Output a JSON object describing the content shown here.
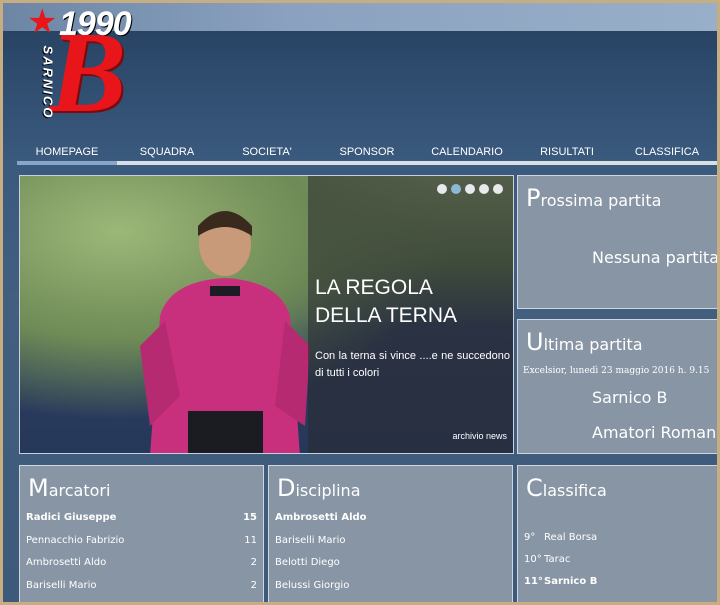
{
  "logo": {
    "year": "1990",
    "letter": "B",
    "name": "SARNICO",
    "star": "★"
  },
  "nav": [
    {
      "label": "HOMEPAGE"
    },
    {
      "label": "SQUADRA"
    },
    {
      "label": "SOCIETA'"
    },
    {
      "label": "SPONSOR"
    },
    {
      "label": "CALENDARIO"
    },
    {
      "label": "RISULTATI"
    },
    {
      "label": "CLASSIFICA"
    }
  ],
  "hero": {
    "title_line1": "LA REGOLA",
    "title_line2": "DELLA TERNA",
    "text": "Con la terna si vince ....e ne succedono di tutti i colori",
    "archive": "archivio news",
    "slides": 5,
    "active_slide": 2
  },
  "next_match": {
    "title_first": "P",
    "title_rest": "rossima partita",
    "status": "Nessuna partita"
  },
  "last_match": {
    "title_first": "U",
    "title_rest": "ltima partita",
    "meta": "Excelsior, lunedì 23 maggio 2016 h. 9.15",
    "home": "Sarnico B",
    "away": "Amatori Romano"
  },
  "scorers": {
    "title_first": "M",
    "title_rest": "arcatori",
    "rows": [
      {
        "name": "Radici Giuseppe",
        "value": "15",
        "bold": true
      },
      {
        "name": "Pennacchio Fabrizio",
        "value": "11",
        "bold": false
      },
      {
        "name": "Ambrosetti Aldo",
        "value": "2",
        "bold": false
      },
      {
        "name": "Bariselli Mario",
        "value": "2",
        "bold": false
      }
    ]
  },
  "discipline": {
    "title_first": "D",
    "title_rest": "isciplina",
    "rows": [
      {
        "name": "Ambrosetti Aldo",
        "bold": true
      },
      {
        "name": "Bariselli Mario",
        "bold": false
      },
      {
        "name": "Belotti Diego",
        "bold": false
      },
      {
        "name": "Belussi Giorgio",
        "bold": false
      }
    ]
  },
  "standings": {
    "title_first": "C",
    "title_rest": "lassifica",
    "rows": [
      {
        "pos": "9°",
        "team": "Real Borsa",
        "bold": false
      },
      {
        "pos": "10°",
        "team": "Tarac",
        "bold": false
      },
      {
        "pos": "11°",
        "team": "Sarnico B",
        "bold": true
      }
    ]
  },
  "colors": {
    "accent_red": "#e8151b",
    "panel": "#8895a4",
    "nav_active": "#8aa6c6"
  }
}
